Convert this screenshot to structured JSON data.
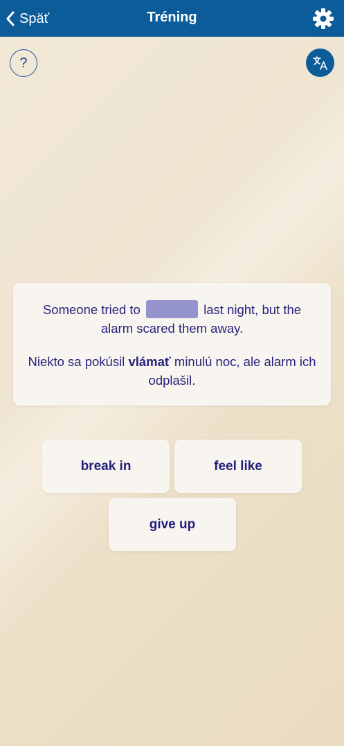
{
  "header": {
    "back_label": "Späť",
    "title": "Tréning"
  },
  "icons": {
    "back": "chevron-left-icon",
    "settings": "gear-icon",
    "help": "question-mark-icon",
    "translate": "translate-icon"
  },
  "help_button": {
    "label": "?"
  },
  "exercise": {
    "sentence_before": "Someone tried to",
    "sentence_after": "last night, but the alarm scared them away.",
    "translation_before": "Niekto sa pokúsil",
    "translation_highlight": "vlámať",
    "translation_after": "minulú noc, ale alarm ich odplašil."
  },
  "options": [
    {
      "label": "break in"
    },
    {
      "label": "feel like"
    },
    {
      "label": "give up"
    }
  ],
  "colors": {
    "header_bg": "#0d5c9a",
    "text": "#26237e",
    "blank": "#9493cb",
    "card_bg": "#f8f5f0"
  }
}
